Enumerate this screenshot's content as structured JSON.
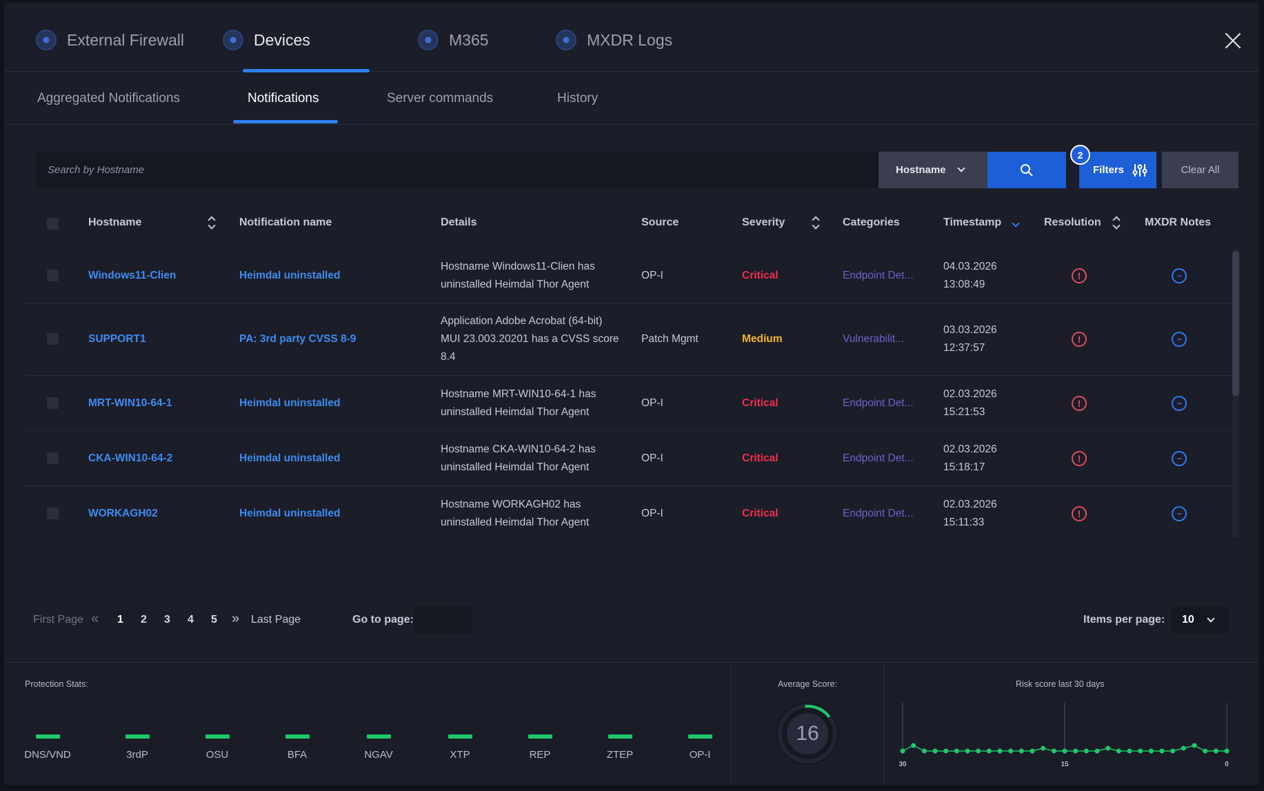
{
  "top_tabs": [
    "External Firewall",
    "Devices",
    "M365",
    "MXDR Logs"
  ],
  "sub_tabs": [
    "Aggregated Notifications",
    "Notifications",
    "Server commands",
    "History"
  ],
  "search": {
    "placeholder": "Search by Hostname",
    "field": "Hostname"
  },
  "filters": {
    "label": "Filters",
    "count": "2",
    "clear_label": "Clear All"
  },
  "columns": [
    "Hostname",
    "Notification name",
    "Details",
    "Source",
    "Severity",
    "Categories",
    "Timestamp",
    "Resolution",
    "MXDR Notes"
  ],
  "rows": [
    {
      "hostname": "Windows11-Clien",
      "notification": "Heimdal uninstalled",
      "details": [
        "Hostname Windows11-Clien has",
        "uninstalled Heimdal Thor Agent"
      ],
      "source": "OP-I",
      "severity": "Critical",
      "category": "Endpoint Det...",
      "date": "04.03.2026",
      "time": "13:08:49"
    },
    {
      "hostname": "SUPPORT1",
      "notification": "PA: 3rd party CVSS 8-9",
      "details": [
        "Application Adobe Acrobat (64-bit)",
        "MUI 23.003.20201 has a CVSS score",
        "8.4"
      ],
      "source": "Patch Mgmt",
      "severity": "Medium",
      "category": "Vulnerabilit...",
      "date": "03.03.2026",
      "time": "12:37:57"
    },
    {
      "hostname": "MRT-WIN10-64-1",
      "notification": "Heimdal uninstalled",
      "details": [
        "Hostname MRT-WIN10-64-1 has",
        "uninstalled Heimdal Thor Agent"
      ],
      "source": "OP-I",
      "severity": "Critical",
      "category": "Endpoint Det...",
      "date": "02.03.2026",
      "time": "15:21:53"
    },
    {
      "hostname": "CKA-WIN10-64-2",
      "notification": "Heimdal uninstalled",
      "details": [
        "Hostname CKA-WIN10-64-2 has",
        "uninstalled Heimdal Thor Agent"
      ],
      "source": "OP-I",
      "severity": "Critical",
      "category": "Endpoint Det...",
      "date": "02.03.2026",
      "time": "15:18:17"
    },
    {
      "hostname": "WORKAGH02",
      "notification": "Heimdal uninstalled",
      "details": [
        "Hostname WORKAGH02 has",
        "uninstalled Heimdal Thor Agent"
      ],
      "source": "OP-I",
      "severity": "Critical",
      "category": "Endpoint Det...",
      "date": "02.03.2026",
      "time": "15:11:33"
    }
  ],
  "pagination": {
    "first": "First Page",
    "last": "Last Page",
    "pages": [
      "1",
      "2",
      "3",
      "4",
      "5"
    ],
    "current": "1",
    "goto_label": "Go to page:",
    "items_label": "Items per page:",
    "items_value": "10"
  },
  "stats": {
    "protection_label": "Protection Stats:",
    "modules": [
      "DNS/VND",
      "3rdP",
      "OSU",
      "BFA",
      "NGAV",
      "XTP",
      "REP",
      "ZTEP",
      "OP-I"
    ],
    "average_label": "Average Score:",
    "average_score": "16",
    "risk_label": "Risk score last 30 days"
  },
  "chart_data": {
    "type": "line",
    "x_tick_labels": [
      "30",
      "15",
      "0"
    ],
    "values": [
      1,
      3,
      1,
      1,
      1,
      1,
      1,
      1,
      1,
      1,
      1,
      1,
      1,
      2,
      1,
      1,
      1,
      1,
      1,
      2,
      1,
      1,
      1,
      1,
      1,
      1,
      2,
      3,
      1,
      1,
      1
    ],
    "grid": "vertical lines at ticks",
    "color": "#1ec86a"
  },
  "colors": {
    "accent": "#1d5fd6",
    "critical": "#f0304b",
    "medium": "#f5b623",
    "category": "#6e60c8",
    "ok": "#1ec86a"
  }
}
